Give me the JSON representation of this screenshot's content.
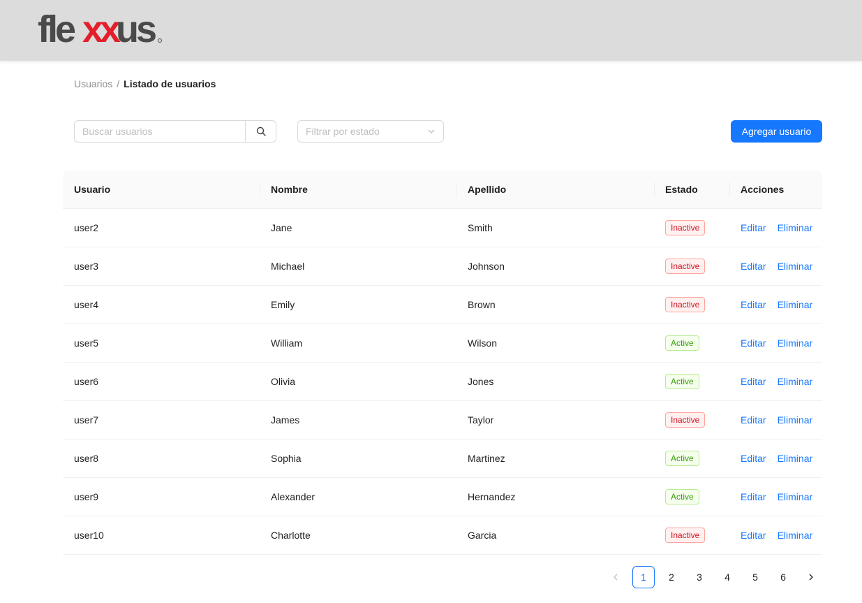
{
  "header": {
    "logo_text": "flexxus",
    "colors": {
      "dark": "#4a4a4a",
      "accent": "#e41e2b",
      "bar": "#dcdcdc"
    }
  },
  "breadcrumb": {
    "parent": "Usuarios",
    "separator": "/",
    "current": "Listado de usuarios"
  },
  "search": {
    "placeholder": "Buscar usuarios",
    "value": "",
    "button_icon": "search-icon"
  },
  "filter": {
    "placeholder": "Filtrar por estado",
    "icon": "chevron-down-icon"
  },
  "add_button": {
    "label": "Agregar usuario",
    "color": "#1677ff"
  },
  "table": {
    "columns": [
      "Usuario",
      "Nombre",
      "Apellido",
      "Estado",
      "Acciones"
    ],
    "rows": [
      {
        "usuario": "user2",
        "nombre": "Jane",
        "apellido": "Smith",
        "estado": "Inactive",
        "estado_type": "inactive"
      },
      {
        "usuario": "user3",
        "nombre": "Michael",
        "apellido": "Johnson",
        "estado": "Inactive",
        "estado_type": "inactive"
      },
      {
        "usuario": "user4",
        "nombre": "Emily",
        "apellido": "Brown",
        "estado": "Inactive",
        "estado_type": "inactive"
      },
      {
        "usuario": "user5",
        "nombre": "William",
        "apellido": "Wilson",
        "estado": "Active",
        "estado_type": "active"
      },
      {
        "usuario": "user6",
        "nombre": "Olivia",
        "apellido": "Jones",
        "estado": "Active",
        "estado_type": "active"
      },
      {
        "usuario": "user7",
        "nombre": "James",
        "apellido": "Taylor",
        "estado": "Inactive",
        "estado_type": "inactive"
      },
      {
        "usuario": "user8",
        "nombre": "Sophia",
        "apellido": "Martinez",
        "estado": "Active",
        "estado_type": "active"
      },
      {
        "usuario": "user9",
        "nombre": "Alexander",
        "apellido": "Hernandez",
        "estado": "Active",
        "estado_type": "active"
      },
      {
        "usuario": "user10",
        "nombre": "Charlotte",
        "apellido": "Garcia",
        "estado": "Inactive",
        "estado_type": "inactive"
      }
    ],
    "actions": {
      "edit": "Editar",
      "delete": "Eliminar"
    }
  },
  "pagination": {
    "prev_icon": "chevron-left-icon",
    "next_icon": "chevron-right-icon",
    "pages": [
      "1",
      "2",
      "3",
      "4",
      "5",
      "6"
    ],
    "current": "1"
  }
}
